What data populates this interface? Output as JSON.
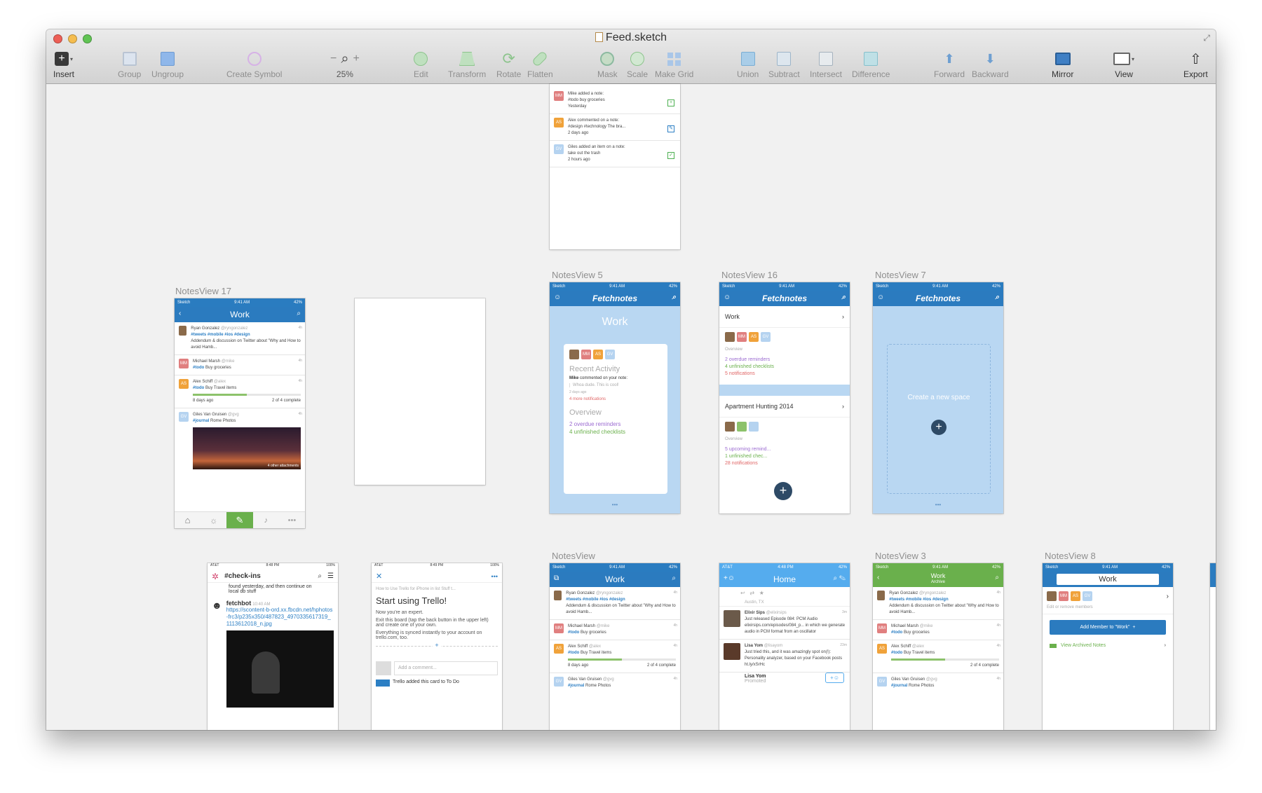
{
  "window": {
    "title": "Feed.sketch",
    "traffic_lights": [
      "#ed5f56",
      "#f5bd4f",
      "#61c454"
    ]
  },
  "toolbar": {
    "insert": "Insert",
    "group": "Group",
    "ungroup": "Ungroup",
    "create_symbol": "Create Symbol",
    "zoom": "25%",
    "edit": "Edit",
    "transform": "Transform",
    "rotate": "Rotate",
    "flatten": "Flatten",
    "mask": "Mask",
    "scale": "Scale",
    "make_grid": "Make Grid",
    "union": "Union",
    "subtract": "Subtract",
    "intersect": "Intersect",
    "difference": "Difference",
    "forward": "Forward",
    "backward": "Backward",
    "mirror": "Mirror",
    "view": "View",
    "export": "Export"
  },
  "artboards": {
    "top": {
      "items": [
        {
          "avatar": "MM",
          "text": "Mike added a note:",
          "sub": "#todo buy groceries",
          "time": "Yesterday"
        },
        {
          "avatar": "AS",
          "text": "Alex commented on a note:",
          "sub": "#design #technology The bra...",
          "time": "2 days ago"
        },
        {
          "avatar": "GV",
          "text": "Giles added an item on a note:",
          "sub": "take out the trash",
          "time": "2 hours ago"
        }
      ]
    },
    "notes17": {
      "label": "NotesView 17",
      "carrier": "Sketch",
      "time": "9:41 AM",
      "battery": "42%",
      "title": "Work",
      "rows": [
        {
          "avatar": "",
          "name": "Ryan Gonzalez",
          "handle": "@ryngonzalez",
          "time": "4h",
          "tags": "#tweets #mobile #ios #design",
          "body": "Addendum & discussion on Twitter about \"Why and How to avoid Hamb..."
        },
        {
          "avatar": "MM",
          "name": "Michael Marsh",
          "handle": "@mike",
          "time": "4h",
          "tags": "#todo",
          "body": "Buy groceries"
        },
        {
          "avatar": "AS",
          "name": "Alex Schiff",
          "handle": "@alex",
          "time": "4h",
          "tags": "#todo",
          "body": "Buy Travel items",
          "meta": "8 days ago",
          "progress": "2 of 4 complete"
        },
        {
          "avatar": "GV",
          "name": "Giles Van Gruisen",
          "handle": "@gvg",
          "time": "4h",
          "tags": "#journal",
          "body": "Rome Photos",
          "attachments": "4 other attachments"
        }
      ]
    },
    "notes5": {
      "label": "NotesView 5",
      "brand": "Fetchnotes",
      "space": "Work",
      "recent": "Recent Activity",
      "comment_user": "Mike",
      "comment": "commented on your note:",
      "quote": "Whoa dude. This is cool!",
      "when": "2 days ago",
      "more": "4 more notifications",
      "overview": "Overview",
      "reminders": "2 overdue reminders",
      "checklists": "4 unfinished checklists"
    },
    "notes16": {
      "label": "NotesView 16",
      "brand": "Fetchnotes",
      "space1": "Work",
      "overview": "Overview",
      "s1_reminders": "2 overdue reminders",
      "s1_checklists": "4 unfinished checklists",
      "s1_notifications": "5 notifications",
      "space2": "Apartment Hunting 2014",
      "s2_reminders": "5 upcoming remind...",
      "s2_checklists": "1 unfinished chec...",
      "s2_notifications": "28 notifications"
    },
    "notes7": {
      "label": "NotesView 7",
      "brand": "Fetchnotes",
      "create": "Create a new space"
    },
    "slack": {
      "carrier": "AT&T",
      "time": "8:48 PM",
      "battery": "100%",
      "channel": "#check-ins",
      "prev": "found yesterday, and then continue on local db stuff",
      "bot": "fetchbot",
      "bot_time": "10:40 AM",
      "url": "https://scontent-b-ord.xx.fbcdn.net/hphotos-frc3/p235x350/487823_4970335617319_1113612018_n.jpg"
    },
    "trello": {
      "carrier": "AT&T",
      "time": "8:49 PM",
      "battery": "100%",
      "crumb": "How to Use Trello for iPhone in list Stuff t...",
      "heading": "Start using Trello!",
      "p1": "Now you're an expert.",
      "p2": "Exit this board (tap the back button in the upper left) and create one of your own.",
      "p3": "Everything is synced instantly to your account on trello.com, too.",
      "comment": "Add a comment...",
      "activity": "Trello added this card to To Do"
    },
    "notesv": {
      "label": "NotesView",
      "title": "Work"
    },
    "twitter": {
      "carrier": "AT&T",
      "time": "4:48 PM",
      "title": "Home",
      "location": "Austin, TX",
      "t1_name": "Elixir Sips",
      "t1_handle": "@elixirsips",
      "t1_time": "3m",
      "t1_text": "Just released Episode 084: PCM Audio elixirsips.com/episodes/084_p... in which we generate audio in PCM format from an oscillator",
      "t2_name": "Lisa Yom",
      "t2_handle": "@lisayom",
      "t2_time": "23m",
      "t2_text": "Just tried this, and it was amazingly spot on(!): Personality analyzer, based on your Facebook posts ht.ly/xSrHc",
      "promo_name": "Lisa Yom",
      "promoted": "Promoted"
    },
    "notes3": {
      "label": "NotesView 3",
      "title": "Work",
      "subtitle": "Archive"
    },
    "notes8": {
      "label": "NotesView 8",
      "title": "Work",
      "edit": "Edit or remove members",
      "add": "Add Member to \"Work\"",
      "archived": "View Archived Notes"
    }
  }
}
